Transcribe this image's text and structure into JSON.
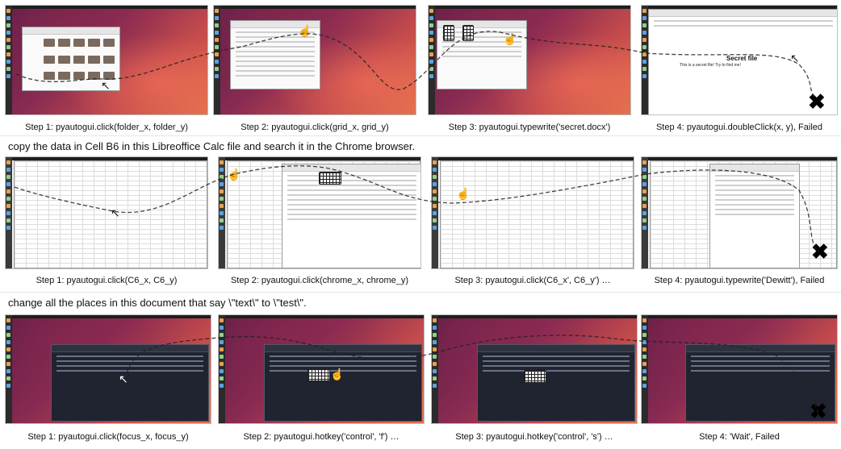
{
  "rows": [
    {
      "task": "",
      "steps": [
        {
          "caption": "Step 1: pyautogui.click(folder_x, folder_y)"
        },
        {
          "caption": "Step 2: pyautogui.click(grid_x, grid_y)"
        },
        {
          "caption": "Step 3: pyautogui.typewrite('secret.docx')"
        },
        {
          "caption": "Step 4: pyautogui.doubleClick(x, y), Failed",
          "doc_title": "Secret file",
          "doc_text": "This is a secret file! Try to find me!"
        }
      ]
    },
    {
      "task": "copy the data in Cell B6 in this Libreoffice Calc file and search it in the Chrome browser.",
      "steps": [
        {
          "caption": "Step 1: pyautogui.click(C6_x, C6_y)"
        },
        {
          "caption": "Step 2: pyautogui.click(chrome_x, chrome_y)"
        },
        {
          "caption": "Step 3: pyautogui.click(C6_x', C6_y') …"
        },
        {
          "caption": "Step 4: pyautogui.typewrite('Dewitt'), Failed"
        }
      ]
    },
    {
      "task": "change all the places in this document that say \\\"text\\\" to \\\"test\\\".",
      "steps": [
        {
          "caption": "Step 1: pyautogui.click(focus_x, focus_y)"
        },
        {
          "caption": "Step 2: pyautogui.hotkey('control', 'f') …"
        },
        {
          "caption": "Step 3: pyautogui.hotkey('control', 's') …"
        },
        {
          "caption": "Step 4: 'Wait', Failed"
        }
      ]
    }
  ],
  "icons": {
    "failure_mark": "cross-mark-icon",
    "pointer": "mouse-pointer-icon",
    "keyboard": "keyboard-icon"
  },
  "colors": {
    "wallpaper_dark": "#5c1d45",
    "wallpaper_light": "#e0714b",
    "trail": "#222222"
  }
}
